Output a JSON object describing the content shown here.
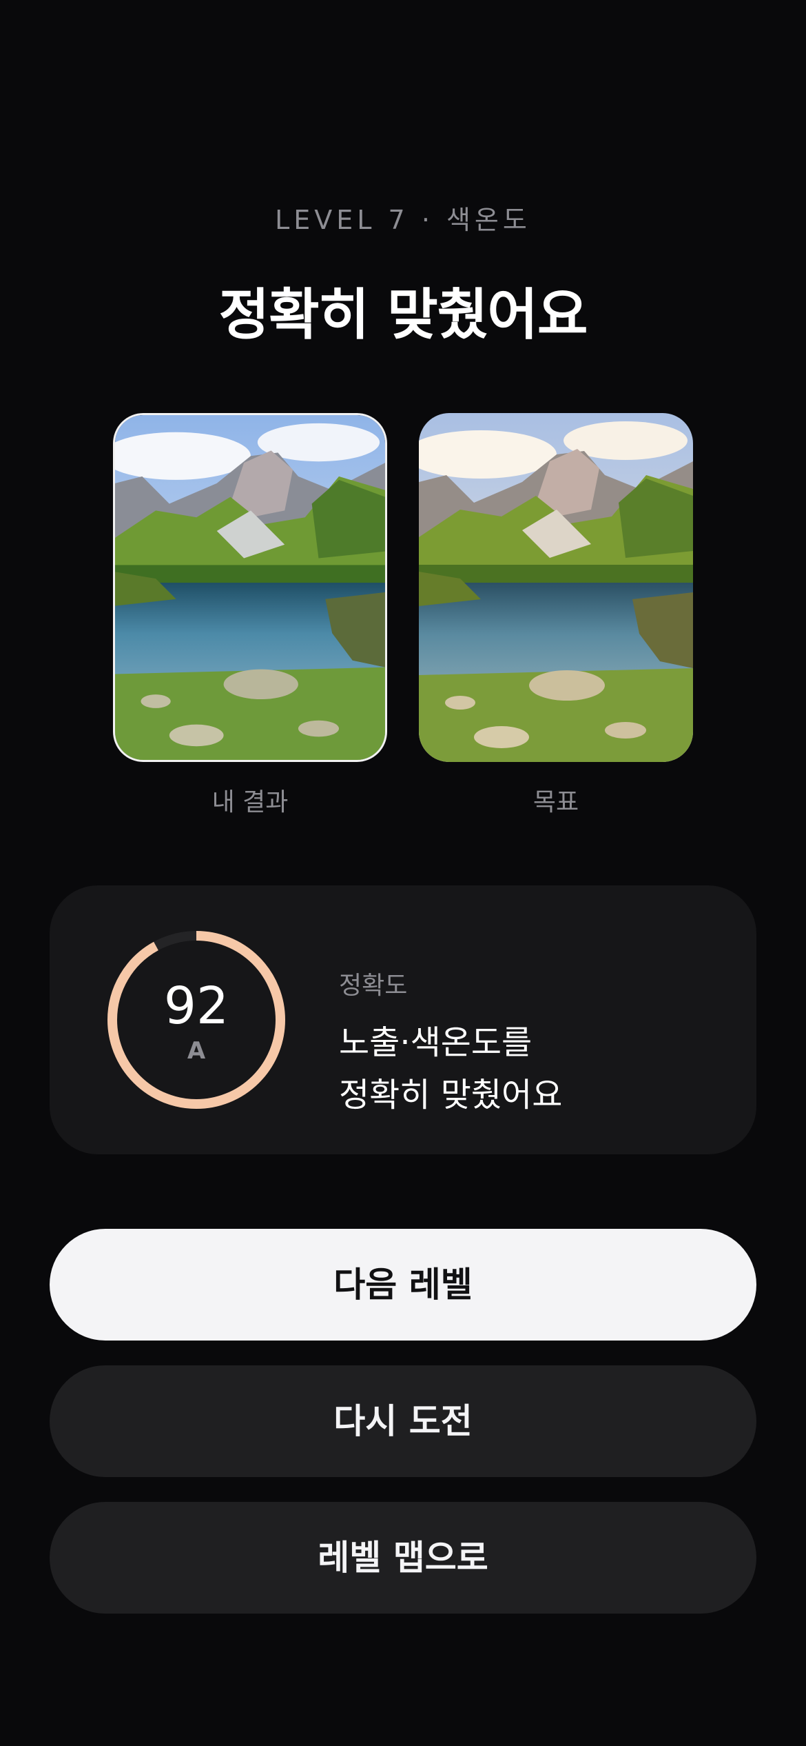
{
  "header": {
    "level_label": "LEVEL 7 · 색온도",
    "title": "정확히 맞췄어요"
  },
  "photos": {
    "mine_caption": "내 결과",
    "target_caption": "목표"
  },
  "score": {
    "value": "92",
    "grade": "A",
    "progress_fraction": 0.92,
    "label": "정확도",
    "message_line1": "노출·색온도를",
    "message_line2": "정확히 맞췄어요",
    "ring_color": "#f6c8a8",
    "track_color": "#242426"
  },
  "actions": {
    "next_label": "다음 레벨",
    "retry_label": "다시 도전",
    "map_label": "레벨 맵으로"
  }
}
